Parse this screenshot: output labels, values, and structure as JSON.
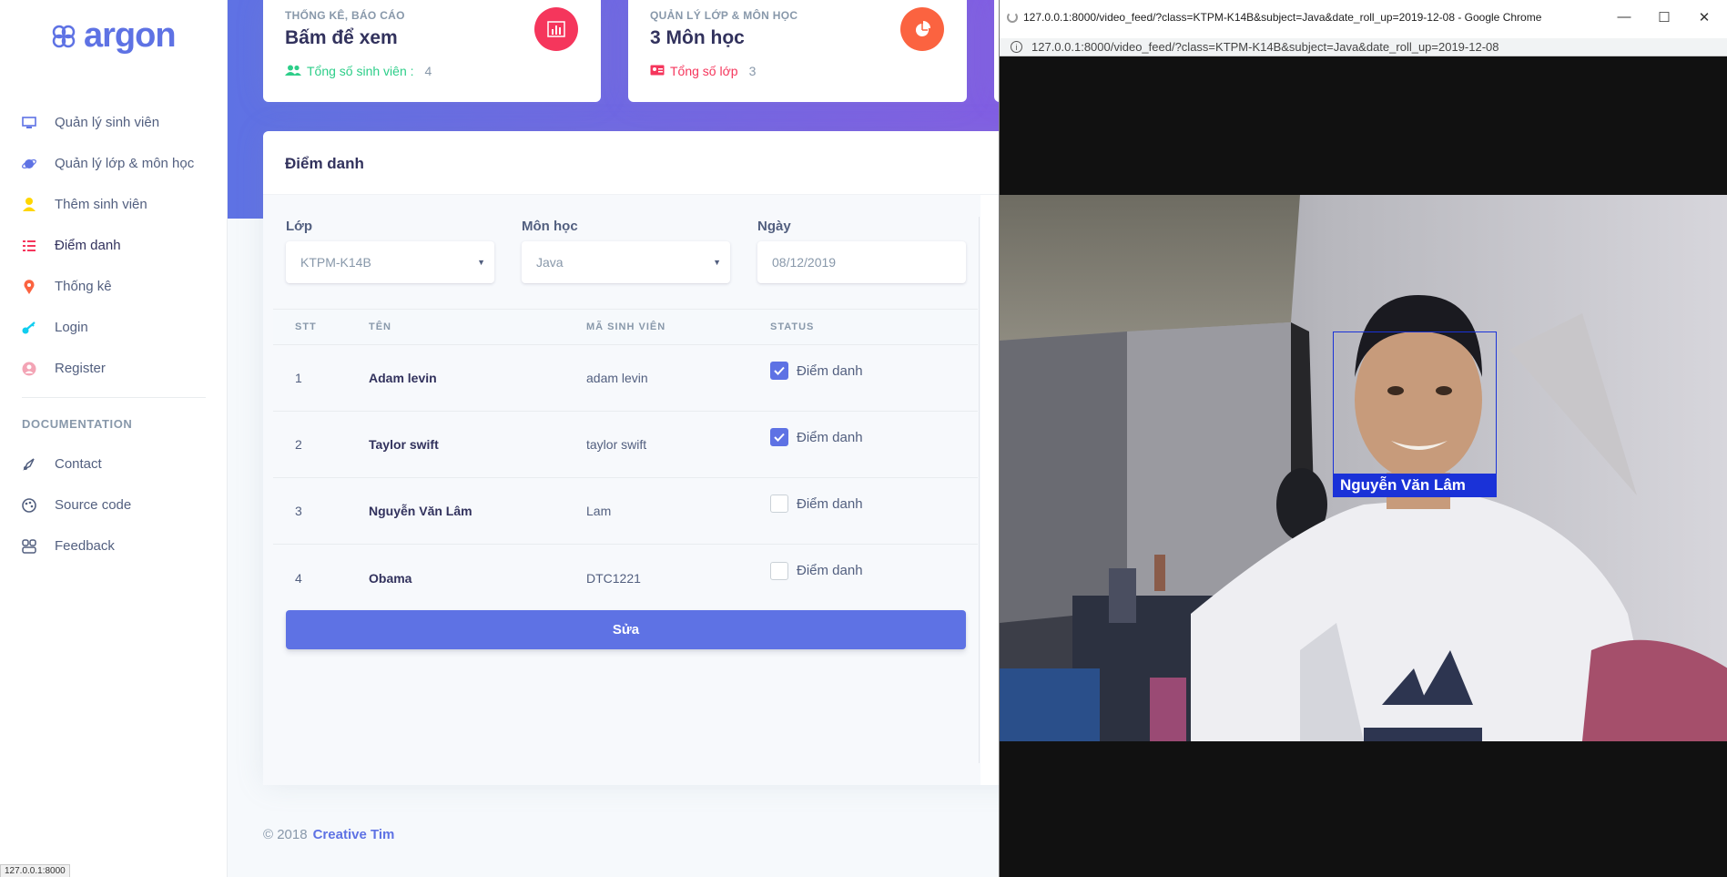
{
  "sidebar": {
    "brand": "argon",
    "items": [
      {
        "label": "Quản lý sinh viên",
        "icon": "tv-icon",
        "color": "#5e72e4"
      },
      {
        "label": "Quản lý lớp & môn học",
        "icon": "planet-icon",
        "color": "#5e72e4"
      },
      {
        "label": "Thêm sinh viên",
        "icon": "user-icon",
        "color": "#ffd600"
      },
      {
        "label": "Điểm danh",
        "icon": "bullet-list-icon",
        "color": "#f5365c"
      },
      {
        "label": "Thống kê",
        "icon": "pin-icon",
        "color": "#fb6340"
      },
      {
        "label": "Login",
        "icon": "key-icon",
        "color": "#11cdef"
      },
      {
        "label": "Register",
        "icon": "circle-user-icon",
        "color": "#f3a4b5"
      }
    ],
    "doc_heading": "DOCUMENTATION",
    "doc_items": [
      {
        "label": "Contact",
        "icon": "spaceship-icon"
      },
      {
        "label": "Source code",
        "icon": "palette-icon"
      },
      {
        "label": "Feedback",
        "icon": "ui-04-icon"
      }
    ]
  },
  "stats": [
    {
      "label": "THỐNG KÊ, BÁO CÁO",
      "value": "Bấm để xem",
      "foot_label": "Tổng số sinh viên :",
      "foot_value": "4",
      "foot_color": "#2dce89",
      "icon_color": "#f5365c",
      "icon": "bar-chart-icon"
    },
    {
      "label": "QUẢN LÝ LỚP & MÔN HỌC",
      "value": "3 Môn học",
      "foot_label": "Tổng số lớp",
      "foot_value": "3",
      "foot_color": "#f5365c",
      "icon_color": "#fb6340",
      "icon": "pie-chart-icon"
    }
  ],
  "attendance": {
    "title": "Điểm danh",
    "fields": {
      "class_label": "Lớp",
      "class_value": "KTPM-K14B",
      "subject_label": "Môn học",
      "subject_value": "Java",
      "date_label": "Ngày",
      "date_value": "08/12/2019"
    },
    "columns": [
      "STT",
      "TÊN",
      "MÃ SINH VIÊN",
      "STATUS"
    ],
    "rows": [
      {
        "stt": "1",
        "name": "Adam levin",
        "code": "adam levin",
        "checked": true,
        "label": "Điểm danh"
      },
      {
        "stt": "2",
        "name": "Taylor swift",
        "code": "taylor swift",
        "checked": true,
        "label": "Điểm danh"
      },
      {
        "stt": "3",
        "name": "Nguyễn Văn Lâm",
        "code": "Lam",
        "checked": false,
        "label": "Điểm danh"
      },
      {
        "stt": "4",
        "name": "Obama",
        "code": "DTC1221",
        "checked": false,
        "label": "Điểm danh"
      }
    ],
    "submit_label": "Sửa"
  },
  "footer": {
    "copyright": "© 2018",
    "author": "Creative Tim"
  },
  "status_url": "127.0.0.1:8000",
  "popup": {
    "title": "127.0.0.1:8000/video_feed/?class=KTPM-K14B&subject=Java&date_roll_up=2019-12-08 - Google Chrome",
    "url": "127.0.0.1:8000/video_feed/?class=KTPM-K14B&subject=Java&date_roll_up=2019-12-08",
    "face_label": "Nguyễn Văn Lâm"
  }
}
